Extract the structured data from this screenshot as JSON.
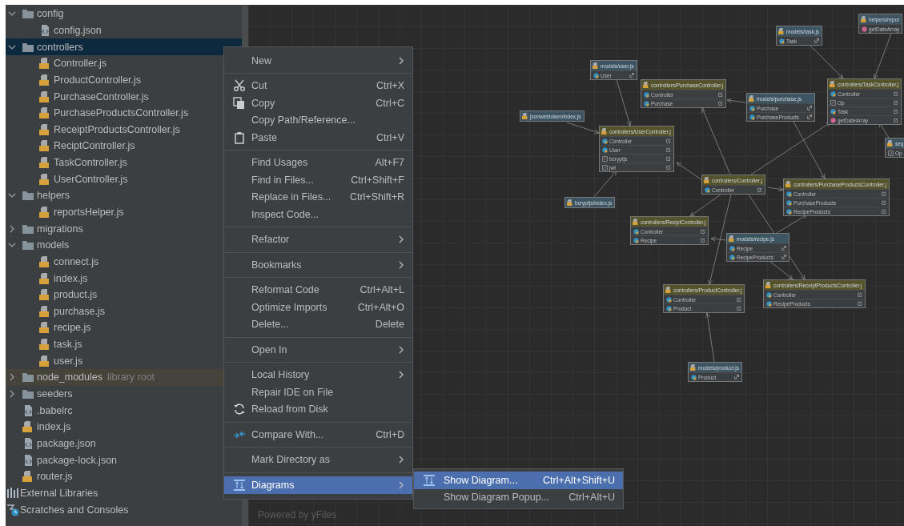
{
  "tree": [
    {
      "kind": "folder",
      "label": "config",
      "expanded": true,
      "selected": false,
      "children": [
        {
          "kind": "config",
          "label": "config.json",
          "selected": false
        }
      ]
    },
    {
      "kind": "folder",
      "label": "controllers",
      "expanded": true,
      "selected": true,
      "children": [
        {
          "kind": "js",
          "label": "Controller.js",
          "selected": false
        },
        {
          "kind": "js",
          "label": "ProductController.js",
          "selected": false
        },
        {
          "kind": "js",
          "label": "PurchaseController.js",
          "selected": false
        },
        {
          "kind": "js",
          "label": "PurchaseProductsController.js",
          "selected": false
        },
        {
          "kind": "js",
          "label": "ReceiptProductsController.js",
          "selected": false
        },
        {
          "kind": "js",
          "label": "ReciptController.js",
          "selected": false
        },
        {
          "kind": "js",
          "label": "TaskController.js",
          "selected": false
        },
        {
          "kind": "js",
          "label": "UserController.js",
          "selected": false
        }
      ]
    },
    {
      "kind": "folder",
      "label": "helpers",
      "expanded": true,
      "selected": false,
      "children": [
        {
          "kind": "js",
          "label": "reportsHelper.js",
          "selected": false
        }
      ]
    },
    {
      "kind": "folder",
      "label": "migrations",
      "expanded": false,
      "selected": false
    },
    {
      "kind": "folder",
      "label": "models",
      "expanded": true,
      "selected": false,
      "children": [
        {
          "kind": "js",
          "label": "connect.js",
          "selected": false
        },
        {
          "kind": "js",
          "label": "index.js",
          "selected": false
        },
        {
          "kind": "js",
          "label": "product.js",
          "selected": false
        },
        {
          "kind": "js",
          "label": "purchase.js",
          "selected": false
        },
        {
          "kind": "js",
          "label": "recipe.js",
          "selected": false
        },
        {
          "kind": "js",
          "label": "task.js",
          "selected": false
        },
        {
          "kind": "js",
          "label": "user.js",
          "selected": false
        }
      ]
    },
    {
      "kind": "folder",
      "label": "node_modules",
      "note": "library root",
      "expanded": false,
      "selected": false
    },
    {
      "kind": "folder",
      "label": "seeders",
      "expanded": false,
      "selected": false
    },
    {
      "kind": "config",
      "label": ".babelrc",
      "selected": false
    },
    {
      "kind": "js",
      "label": "index.js",
      "selected": false
    },
    {
      "kind": "config",
      "label": "package.json",
      "selected": false
    },
    {
      "kind": "config",
      "label": "package-lock.json",
      "selected": false
    },
    {
      "kind": "js",
      "label": "router.js",
      "selected": false
    },
    {
      "kind": "libraries",
      "label": "External Libraries",
      "selected": false
    },
    {
      "kind": "scratches",
      "label": "Scratches and Consoles",
      "selected": false
    }
  ],
  "menu": {
    "sections": [
      [
        {
          "label": "New",
          "has_submenu": true,
          "selected": false
        }
      ],
      [
        {
          "label": "Cut",
          "shortcut": "Ctrl+X",
          "has_submenu": false,
          "selected": false
        },
        {
          "label": "Copy",
          "shortcut": "Ctrl+C",
          "has_submenu": false,
          "selected": false
        },
        {
          "label": "Copy Path/Reference...",
          "has_submenu": false,
          "selected": false
        },
        {
          "label": "Paste",
          "shortcut": "Ctrl+V",
          "has_submenu": false,
          "selected": false
        }
      ],
      [
        {
          "label": "Find Usages",
          "shortcut": "Alt+F7",
          "has_submenu": false,
          "selected": false
        },
        {
          "label": "Find in Files...",
          "shortcut": "Ctrl+Shift+F",
          "has_submenu": false,
          "selected": false
        },
        {
          "label": "Replace in Files...",
          "shortcut": "Ctrl+Shift+R",
          "has_submenu": false,
          "selected": false
        },
        {
          "label": "Inspect Code...",
          "has_submenu": false,
          "selected": false
        }
      ],
      [
        {
          "label": "Refactor",
          "has_submenu": true,
          "selected": false
        }
      ],
      [
        {
          "label": "Bookmarks",
          "has_submenu": true,
          "selected": false
        }
      ],
      [
        {
          "label": "Reformat Code",
          "shortcut": "Ctrl+Alt+L",
          "has_submenu": false,
          "selected": false
        },
        {
          "label": "Optimize Imports",
          "shortcut": "Ctrl+Alt+O",
          "has_submenu": false,
          "selected": false
        },
        {
          "label": "Delete...",
          "shortcut": "Delete",
          "has_submenu": false,
          "selected": false
        }
      ],
      [
        {
          "label": "Open In",
          "has_submenu": true,
          "selected": false
        }
      ],
      [
        {
          "label": "Local History",
          "has_submenu": true,
          "selected": false
        },
        {
          "label": "Repair IDE on File",
          "has_submenu": false,
          "selected": false
        },
        {
          "label": "Reload from Disk",
          "has_submenu": false,
          "selected": false
        }
      ],
      [
        {
          "label": "Compare With...",
          "shortcut": "Ctrl+D",
          "has_submenu": false,
          "selected": false
        }
      ],
      [
        {
          "label": "Mark Directory as",
          "has_submenu": true,
          "selected": false
        }
      ],
      [
        {
          "label": "Diagrams",
          "has_submenu": true,
          "selected": true
        }
      ]
    ]
  },
  "submenu": [
    {
      "label": "Show Diagram...",
      "shortcut": "Ctrl+Alt+Shift+U",
      "selected": true
    },
    {
      "label": "Show Diagram Popup...",
      "shortcut": "Ctrl+Alt+U",
      "selected": false
    }
  ],
  "diagram": {
    "nodes": [
      {
        "kind": "helper",
        "title": "helpers/repor",
        "members": [
          {
            "kind": "function",
            "name": "getDateArray"
          }
        ]
      },
      {
        "kind": "model",
        "title": "models/task.js",
        "members": [
          {
            "kind": "class",
            "name": "Task"
          }
        ]
      },
      {
        "kind": "model",
        "title": "models/user.js",
        "members": [
          {
            "kind": "class",
            "name": "User"
          }
        ]
      },
      {
        "kind": "library",
        "title": "jsonwebtoken/index.js"
      },
      {
        "kind": "controller",
        "title": "controllers/PurchaseController.j",
        "members": [
          {
            "kind": "class",
            "name": "Controller"
          },
          {
            "kind": "class",
            "name": "Purchase"
          }
        ]
      },
      {
        "kind": "model",
        "title": "models/purchase.js",
        "members": [
          {
            "kind": "class",
            "name": "Purchase"
          },
          {
            "kind": "class",
            "name": "PurchaseProducts"
          }
        ]
      },
      {
        "kind": "controller",
        "title": "controllers/TaskController.j",
        "members": [
          {
            "kind": "class",
            "name": "Controller"
          },
          {
            "kind": "field",
            "name": "Op"
          },
          {
            "kind": "class",
            "name": "Task"
          },
          {
            "kind": "function",
            "name": "getDateArray"
          }
        ]
      },
      {
        "kind": "controller",
        "title": "controllers/UserController.j",
        "members": [
          {
            "kind": "class",
            "name": "Controller"
          },
          {
            "kind": "class",
            "name": "User"
          },
          {
            "kind": "field",
            "name": "bcryptjs"
          },
          {
            "kind": "field",
            "name": "jwt"
          }
        ]
      },
      {
        "kind": "helper",
        "title": "seq",
        "members": [
          {
            "kind": "field",
            "name": "Op"
          }
        ]
      },
      {
        "kind": "controller",
        "title": "controllers/Controller.j",
        "members": [
          {
            "kind": "class",
            "name": "Controller"
          }
        ]
      },
      {
        "kind": "controller",
        "title": "controllers/PurchaseProductsController.j",
        "members": [
          {
            "kind": "class",
            "name": "Controller"
          },
          {
            "kind": "class",
            "name": "PurchaseProducts"
          },
          {
            "kind": "class",
            "name": "RecipeProducts"
          }
        ]
      },
      {
        "kind": "library",
        "title": "bcryptjs/index.js"
      },
      {
        "kind": "controller",
        "title": "controllers/ReciptController.j",
        "members": [
          {
            "kind": "class",
            "name": "Controller"
          },
          {
            "kind": "class",
            "name": "Recipe"
          }
        ]
      },
      {
        "kind": "model",
        "title": "models/recipe.js",
        "members": [
          {
            "kind": "class",
            "name": "Recipe"
          },
          {
            "kind": "class",
            "name": "RecipeProducts"
          }
        ]
      },
      {
        "kind": "controller",
        "title": "controllers/ReceiptProductsController.j",
        "members": [
          {
            "kind": "class",
            "name": "Controller"
          },
          {
            "kind": "class",
            "name": "RecipeProducts"
          }
        ]
      },
      {
        "kind": "controller",
        "title": "controllers/ProductController.j",
        "members": [
          {
            "kind": "class",
            "name": "Controller"
          },
          {
            "kind": "class",
            "name": "Product"
          }
        ]
      },
      {
        "kind": "model",
        "title": "models/product.js",
        "members": [
          {
            "kind": "class",
            "name": "Product"
          }
        ]
      }
    ],
    "footer_note": "Powered by yFiles"
  }
}
